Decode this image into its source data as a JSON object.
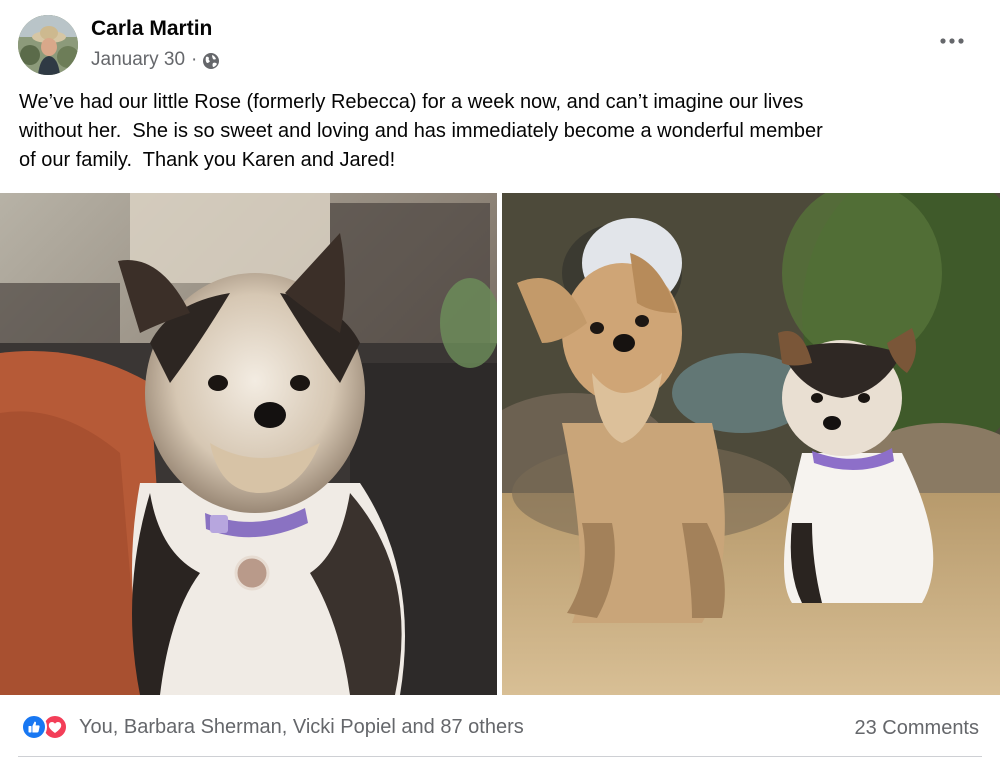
{
  "post": {
    "author": "Carla Martin",
    "date": "January 30",
    "separator": "·",
    "privacy_icon": "globe-icon",
    "more_icon": "more-options-icon",
    "text": "We’ve had our little Rose (formerly Rebecca) for a week now, and can’t imagine our lives\nwithout her.  She is so sweet and loving and has immediately become a wonderful member\nof our family.  Thank you Karen and Jared!"
  },
  "reactions": {
    "icons": [
      "like-icon",
      "love-icon"
    ],
    "summary": "You, Barbara Sherman, Vicki Popiel and 87 others"
  },
  "comments": {
    "label": "23 Comments"
  },
  "colors": {
    "like": "#1877f2",
    "love": "#f33e58",
    "secondary_text": "#65676b"
  }
}
